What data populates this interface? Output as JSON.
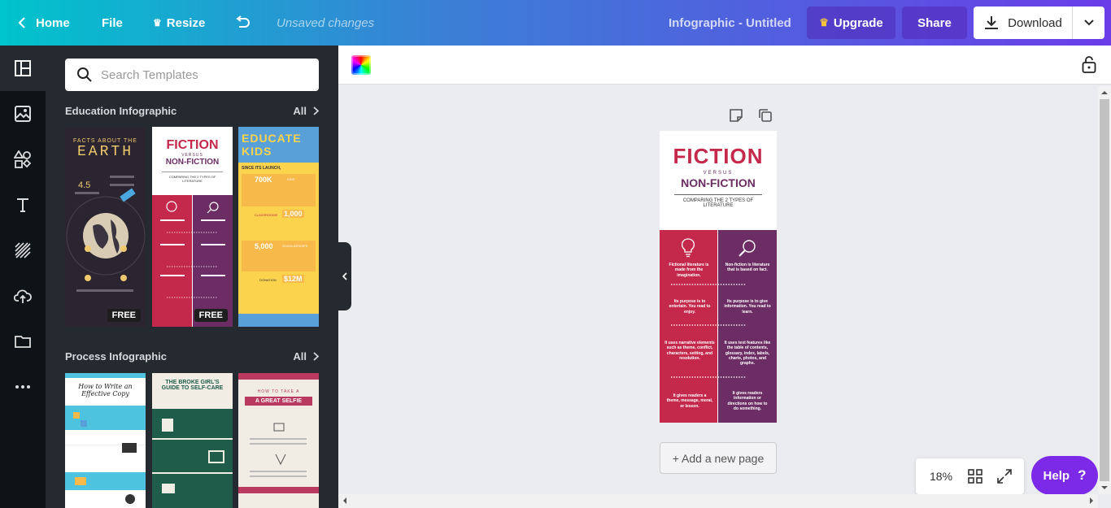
{
  "topbar": {
    "home": "Home",
    "file": "File",
    "resize": "Resize",
    "unsaved": "Unsaved changes",
    "doc_title": "Infographic - Untitled",
    "upgrade": "Upgrade",
    "share": "Share",
    "download": "Download"
  },
  "panel": {
    "search_placeholder": "Search Templates",
    "sections": [
      {
        "title": "Education Infographic",
        "all": "All"
      },
      {
        "title": "Process Infographic",
        "all": "All"
      }
    ],
    "badge_free": "FREE",
    "thumbs": {
      "earth": {
        "t1": "FACTS ABOUT THE",
        "t2": "EARTH",
        "num": "4.5"
      },
      "fiction": {
        "t1": "FICTION",
        "t2": "VERSUS",
        "t3": "NON-FICTION",
        "t4": "COMPARING THE 2 TYPES OF LITERATURE"
      },
      "educate": {
        "t1": "EDUCATE",
        "t2": "KIDS",
        "s1": "SINCE ITS LAUNCH,",
        "n1": "700K",
        "n2": "1,000",
        "n3": "5,000",
        "n4": "$12M",
        "l1": "KIDS",
        "l2": "CLASSROOMS",
        "l3": "SCHOLARSHIPS",
        "l4": "DONATION"
      },
      "write": {
        "t1": "How to Write an",
        "t2": "Effective Copy"
      },
      "broke": {
        "t1": "THE BROKE GIRL'S",
        "t2": "GUIDE TO SELF-CARE"
      },
      "selfie": {
        "t1": "HOW TO TAKE A",
        "t2": "A GREAT SELFIE"
      }
    }
  },
  "canvas": {
    "title": "FICTION",
    "versus": "VERSUS",
    "subtitle": "NON-FICTION",
    "tagline": "COMPARING THE 2 TYPES OF LITERATURE",
    "left": [
      "Fictional literature is made from the imagination.",
      "Its purpose is to entertain. You read to enjoy.",
      "It uses narrative elements such as theme, conflict, characters, setting, and resolution.",
      "It gives readers a theme, message, moral, or lesson."
    ],
    "right": [
      "Non-fiction is literature that is based on fact.",
      "Its purpose is to give information. You read to learn.",
      "It uses text features like the table of contents, glossary, index, labels, charts, photos, and graphs.",
      "It gives readers information or directions on how to do something."
    ],
    "add_page": "+ Add a new page"
  },
  "zoom": {
    "value": "18%"
  },
  "help": {
    "label": "Help",
    "icon": "?"
  },
  "colors": {
    "crimson": "#c4284b",
    "plum": "#6b2d63",
    "accent": "#7d2ae8"
  }
}
